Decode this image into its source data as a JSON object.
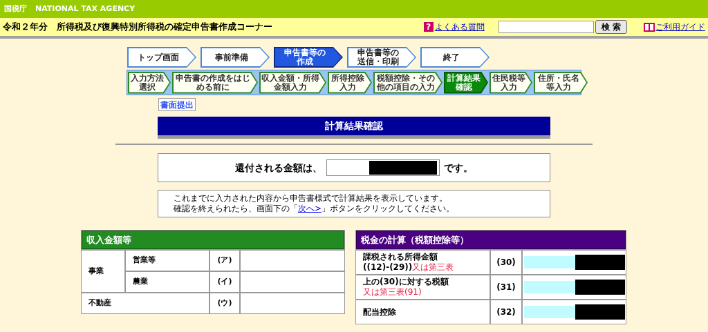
{
  "top_bar": {
    "agency": "国税庁",
    "agency_en": "NATIONAL TAX AGENCY"
  },
  "title_bar": {
    "title": "令和２年分　所得税及び復興特別所得税の確定申告書作成コーナー",
    "faq_icon": "?",
    "faq_link": "よくある質問",
    "search_button": "検 索",
    "guide_link": "ご利用ガイド"
  },
  "steps": [
    {
      "lines": [
        "トップ画面"
      ],
      "selected": false
    },
    {
      "lines": [
        "事前準備"
      ],
      "selected": false
    },
    {
      "lines": [
        "申告書等の",
        "作成"
      ],
      "selected": true
    },
    {
      "lines": [
        "申告書等の",
        "送信・印刷"
      ],
      "selected": false
    },
    {
      "lines": [
        "終了"
      ],
      "selected": false
    }
  ],
  "substeps": [
    {
      "lines": [
        "入力方法",
        "選択"
      ],
      "selected": false
    },
    {
      "lines": [
        "申告書の作成をはじ",
        "める前に"
      ],
      "selected": false
    },
    {
      "lines": [
        "収入金額・所得",
        "金額入力"
      ],
      "selected": false
    },
    {
      "lines": [
        "所得控除",
        "入力"
      ],
      "selected": false
    },
    {
      "lines": [
        "税額控除・その",
        "他の項目の入力"
      ],
      "selected": false
    },
    {
      "lines": [
        "計算結果",
        "確認"
      ],
      "selected": true
    },
    {
      "lines": [
        "住民税等",
        "入力"
      ],
      "selected": false
    },
    {
      "lines": [
        "住所・氏名",
        "等入力"
      ],
      "selected": false
    }
  ],
  "paper_button": "書面提出",
  "page_heading": "計算結果確認",
  "refund": {
    "prefix": "還付される金額は、",
    "suffix": "です。",
    "redacted": true
  },
  "notice": {
    "line_1": "これまでに入力された内容から申告書様式で計算結果を表示しています。",
    "line_2_before": "確認を終えられたら、画面下の「",
    "line_2_link": "次へ>",
    "line_2_after": "」ボタンをクリックしてください。"
  },
  "income_table": {
    "title": "収入金額等",
    "groups": [
      {
        "label": "事業",
        "rows": [
          {
            "label": "営業等",
            "code": "(ア)"
          },
          {
            "label": "農業",
            "code": "(イ)"
          }
        ]
      },
      {
        "label": "不動産",
        "rows": [
          {
            "label": "",
            "code": "(ウ)"
          }
        ]
      }
    ]
  },
  "tax_table": {
    "title": "税金の計算（税額控除等）",
    "rows": [
      {
        "lines": [
          [
            {
              "text": "課税される所得金額",
              "highlighted": false
            }
          ],
          [
            {
              "text": "((12)-(29))",
              "highlighted": false
            },
            {
              "text": "又は第三表",
              "highlighted": true
            }
          ]
        ],
        "code": "(30)",
        "redacted": true
      },
      {
        "lines": [
          [
            {
              "text": "上の(30)に対する税額",
              "highlighted": false
            }
          ],
          [
            {
              "text": "又は第三表(91)",
              "highlighted": true
            }
          ]
        ],
        "code": "(31)",
        "redacted": true
      },
      {
        "lines": [
          [
            {
              "text": "配当控除",
              "highlighted": false
            }
          ]
        ],
        "code": "(32)",
        "redacted": true
      }
    ]
  }
}
